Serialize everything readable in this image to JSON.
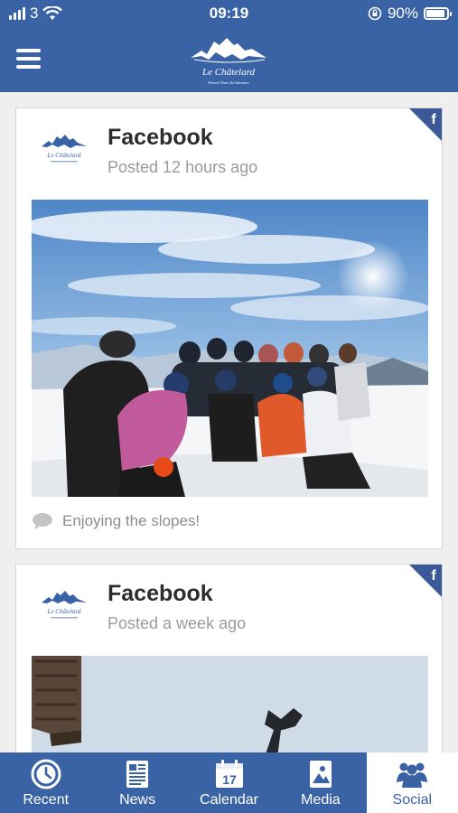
{
  "status_bar": {
    "carrier": "3",
    "time": "09:19",
    "battery_percent": "90%",
    "battery_level": 0.9
  },
  "header": {
    "logo_text": "Le Châtelard",
    "logo_tagline": "Pinnacle Winter Ski Adventures",
    "menu_icon": "hamburger-icon"
  },
  "feed": {
    "posts": [
      {
        "source": "Facebook",
        "time": "Posted 12 hours ago",
        "caption": "Enjoying the slopes!",
        "badge_icon": "facebook-icon"
      },
      {
        "source": "Facebook",
        "time": "Posted a week ago",
        "badge_icon": "facebook-icon"
      }
    ]
  },
  "tabs": [
    {
      "label": "Recent",
      "icon": "clock-icon",
      "active": false
    },
    {
      "label": "News",
      "icon": "newspaper-icon",
      "active": false
    },
    {
      "label": "Calendar",
      "icon": "calendar-icon",
      "icon_text": "17",
      "active": false
    },
    {
      "label": "Media",
      "icon": "image-icon",
      "active": false
    },
    {
      "label": "Social",
      "icon": "people-icon",
      "active": true
    }
  ],
  "colors": {
    "brand_blue": "#3a63a5",
    "background": "#efefef",
    "facebook_blue": "#3b5998"
  }
}
